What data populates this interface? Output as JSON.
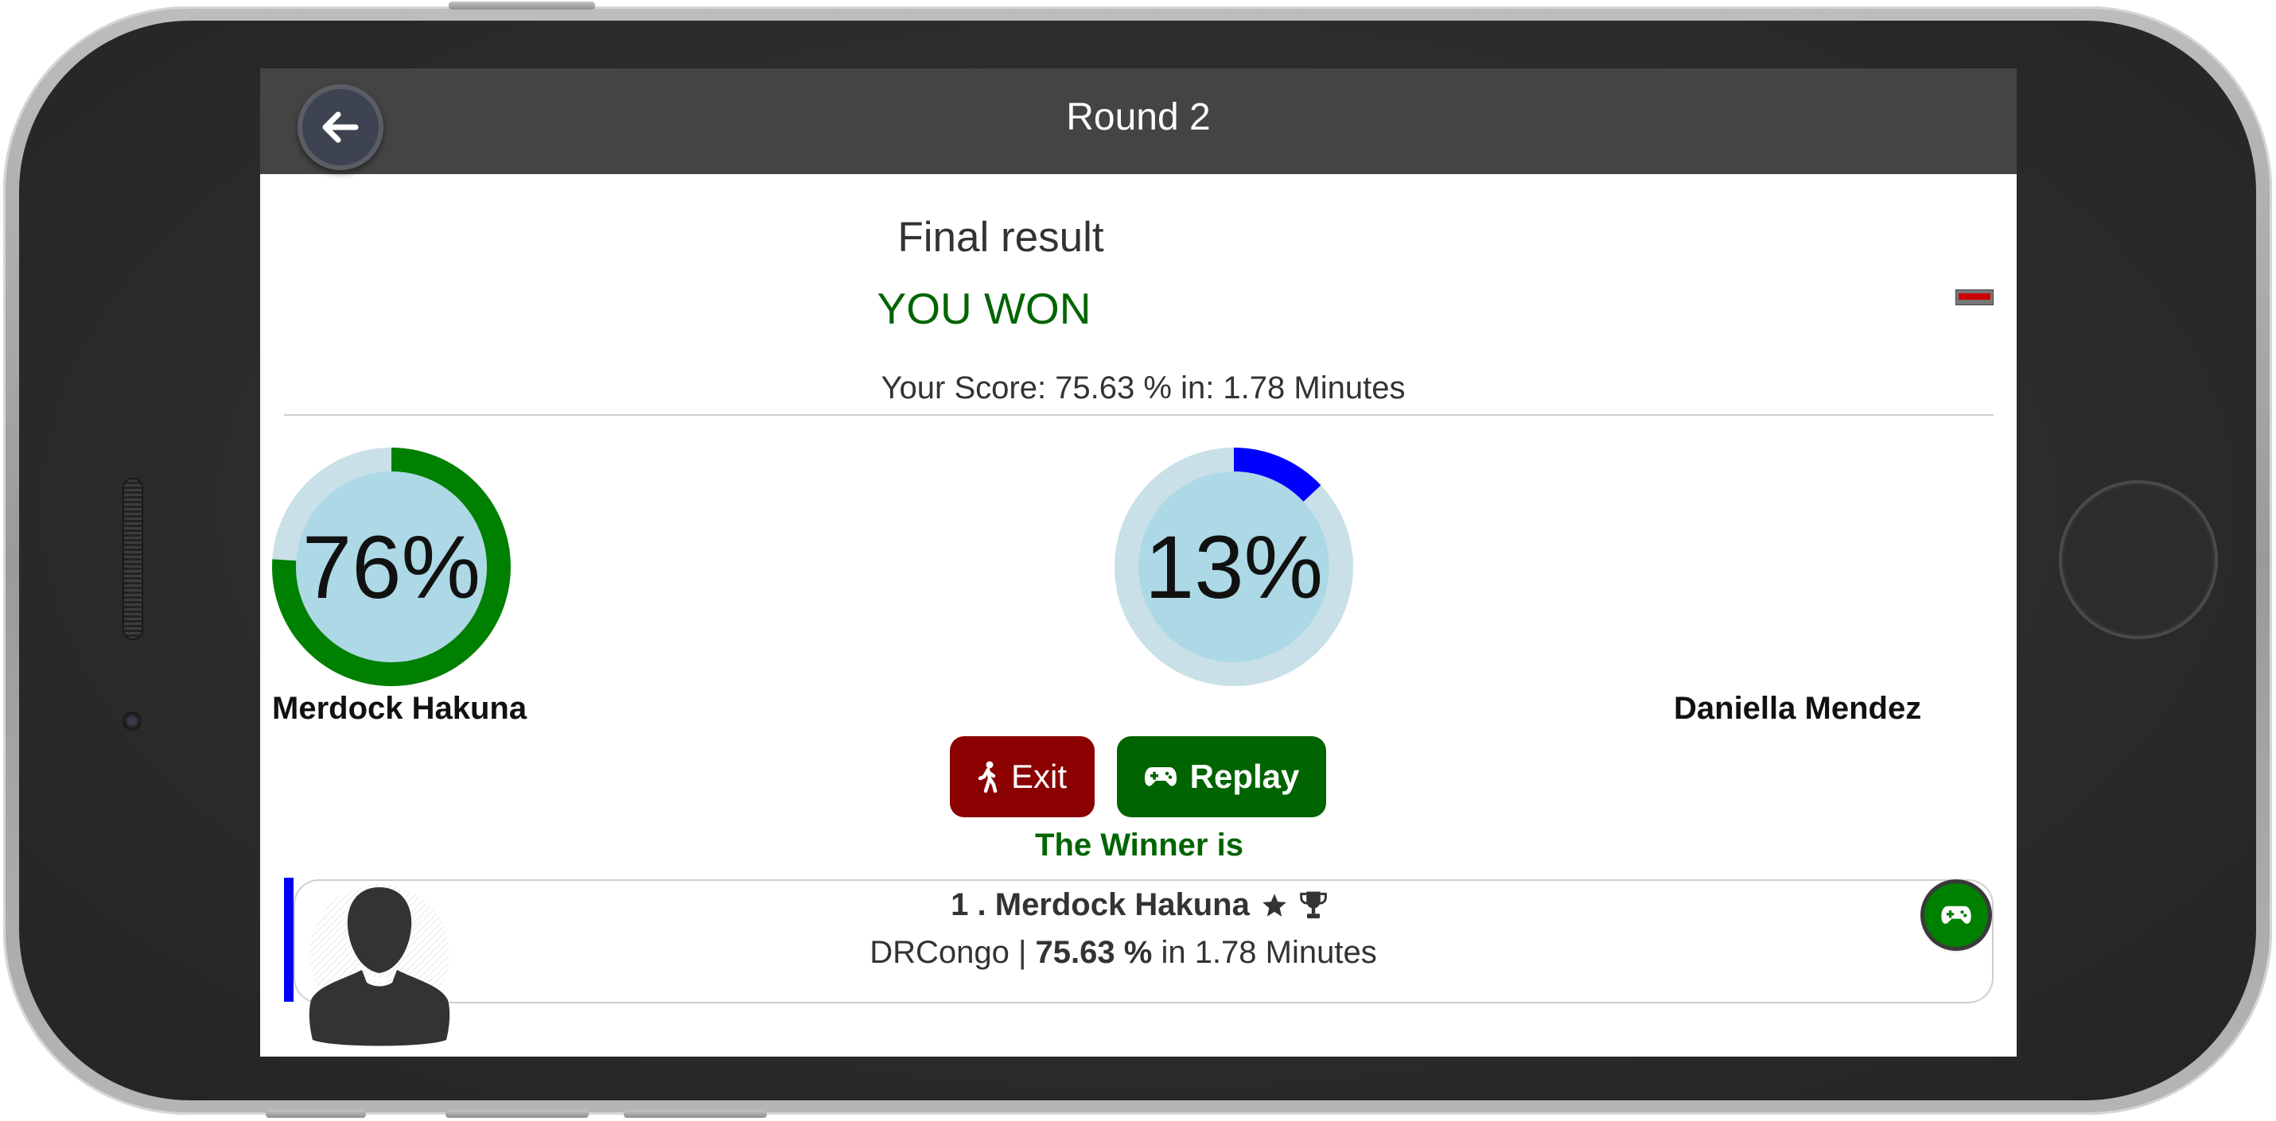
{
  "header": {
    "title": "Round 2"
  },
  "result": {
    "title": "Final result",
    "outcome": "YOU WON",
    "score_line": "Your Score: 75.63 % in: 1.78 Minutes"
  },
  "players": [
    {
      "name": "Merdock Hakuna",
      "percent_label": "76%",
      "fraction": 0.76,
      "ring_color": "#008000"
    },
    {
      "name": "Daniella Mendez",
      "percent_label": "13%",
      "fraction": 0.13,
      "ring_color": "#0000ff"
    }
  ],
  "actions": {
    "exit_label": "Exit",
    "replay_label": "Replay"
  },
  "winner": {
    "heading": "The Winner is",
    "rank_name": "1 . Merdock Hakuna",
    "country": "DRCongo",
    "separator": " | ",
    "score": "75.63 %",
    "time_text": " in 1.78 Minutes"
  },
  "colors": {
    "header_bg": "#444444",
    "win_green": "#006400",
    "exit_red": "#8b0000",
    "ring_track": "#c9e0e8",
    "ring_inner": "#add8e6",
    "accent_blue": "#0000ff"
  },
  "icons": {
    "back": "arrow-left-icon",
    "exit": "walking-person-icon",
    "replay": "gamepad-icon",
    "star": "star-icon",
    "trophy": "trophy-icon",
    "avatar": "user-silhouette-icon"
  }
}
